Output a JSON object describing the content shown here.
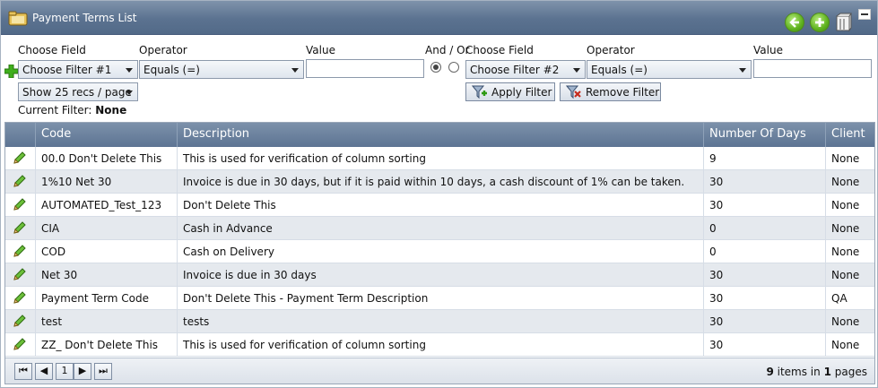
{
  "window": {
    "title": "Payment Terms List"
  },
  "toolbar": {
    "back_icon": "back-arrow-icon",
    "add_icon": "add-icon",
    "columns_icon": "column-chooser-icon",
    "minimize_icon": "minimize-icon"
  },
  "filter": {
    "left": {
      "choose_field_label": "Choose Field",
      "operator_label": "Operator",
      "value_label": "Value",
      "choose_field_value": "Choose Filter #1",
      "operator_value": "Equals (=)",
      "value": ""
    },
    "and_or_label": "And / Or",
    "and_selected": true,
    "right": {
      "choose_field_label": "Choose Field",
      "operator_label": "Operator",
      "value_label": "Value",
      "choose_field_value": "Choose Filter #2",
      "operator_value": "Equals (=)",
      "value": ""
    },
    "page_size": "Show 25 recs / page",
    "apply_label": "Apply Filter",
    "remove_label": "Remove Filter",
    "current_filter_label": "Current Filter:",
    "current_filter_value": "None"
  },
  "grid": {
    "columns": [
      "Code",
      "Description",
      "Number Of Days",
      "Client"
    ],
    "rows": [
      {
        "code": "00.0 Don't Delete This",
        "description": "This is used for verification of column sorting",
        "days": "9",
        "client": "None"
      },
      {
        "code": "1%10 Net 30",
        "description": "Invoice is due in 30 days, but if it is paid within 10 days, a cash discount of 1% can be taken.",
        "days": "30",
        "client": "None"
      },
      {
        "code": "AUTOMATED_Test_123",
        "description": "Don't Delete This",
        "days": "30",
        "client": "None"
      },
      {
        "code": "CIA",
        "description": "Cash in Advance",
        "days": "0",
        "client": "None"
      },
      {
        "code": "COD",
        "description": "Cash on Delivery",
        "days": "0",
        "client": "None"
      },
      {
        "code": "Net 30",
        "description": "Invoice is due in 30 days",
        "days": "30",
        "client": "None"
      },
      {
        "code": "Payment Term Code",
        "description": "Don't Delete This - Payment Term Description",
        "days": "30",
        "client": "QA"
      },
      {
        "code": "test",
        "description": "tests",
        "days": "30",
        "client": "None"
      },
      {
        "code": "ZZ_ Don't Delete This",
        "description": "This is used for verification of column sorting",
        "days": "30",
        "client": "None"
      }
    ],
    "pager": {
      "current_page": "1",
      "items_count": "9",
      "items_text": "items in",
      "pages_count": "1",
      "pages_text": "pages"
    }
  }
}
